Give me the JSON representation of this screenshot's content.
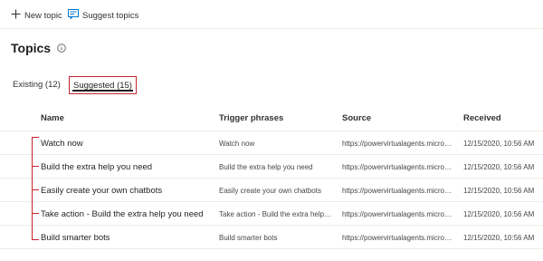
{
  "toolbar": {
    "new_topic": "New topic",
    "suggest_topics": "Suggest topics"
  },
  "page": {
    "title": "Topics"
  },
  "tabs": [
    {
      "label": "Existing (12)",
      "selected": false
    },
    {
      "label": "Suggested (15)",
      "selected": true
    }
  ],
  "table": {
    "columns": {
      "name": "Name",
      "trigger": "Trigger phrases",
      "source": "Source",
      "received": "Received"
    },
    "rows": [
      {
        "name": "Watch now",
        "trigger": "Watch now",
        "source": "https://powervirtualagents.microsoft.com",
        "received": "12/15/2020, 10:56 AM"
      },
      {
        "name": "Build the extra help you need",
        "trigger": "Build the extra help you need",
        "source": "https://powervirtualagents.microsoft.com",
        "received": "12/15/2020, 10:56 AM"
      },
      {
        "name": "Easily create your own chatbots",
        "trigger": "Easily create your own chatbots",
        "source": "https://powervirtualagents.microsoft.com",
        "received": "12/15/2020, 10:56 AM"
      },
      {
        "name": "Take action - Build the extra help you need",
        "trigger": "Take action - Build the extra help you need",
        "source": "https://powervirtualagents.microsoft.com",
        "received": "12/15/2020, 10:56 AM"
      },
      {
        "name": "Build smarter bots",
        "trigger": "Build smarter bots",
        "source": "https://powervirtualagents.microsoft.com",
        "received": "12/15/2020, 10:56 AM"
      }
    ]
  },
  "colors": {
    "highlight": "#c4262e",
    "accent": "#0078d4"
  }
}
